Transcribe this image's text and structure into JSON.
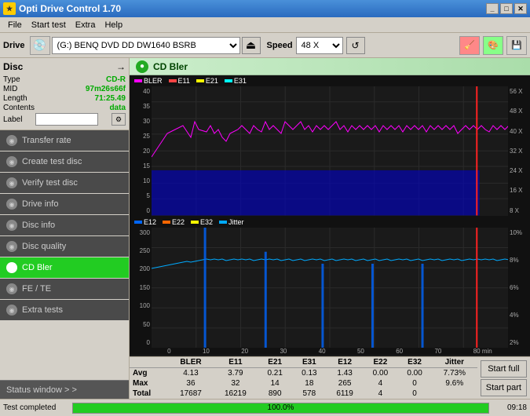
{
  "titleBar": {
    "title": "Opti Drive Control 1.70",
    "icon": "★"
  },
  "menuBar": {
    "items": [
      "File",
      "Start test",
      "Extra",
      "Help"
    ]
  },
  "toolbar": {
    "driveLabel": "Drive",
    "driveValue": "(G:)  BENQ DVD DD DW1640 BSRB",
    "speedLabel": "Speed",
    "speedValue": "48 X"
  },
  "disc": {
    "title": "Disc",
    "fields": [
      {
        "key": "Type",
        "value": "CD-R"
      },
      {
        "key": "MID",
        "value": "97m26s66f"
      },
      {
        "key": "Length",
        "value": "71:25.49"
      },
      {
        "key": "Contents",
        "value": "data"
      },
      {
        "key": "Label",
        "value": ""
      }
    ]
  },
  "sidebar": {
    "navItems": [
      {
        "id": "transfer-rate",
        "label": "Transfer rate",
        "active": false
      },
      {
        "id": "create-test-disc",
        "label": "Create test disc",
        "active": false
      },
      {
        "id": "verify-test-disc",
        "label": "Verify test disc",
        "active": false
      },
      {
        "id": "drive-info",
        "label": "Drive info",
        "active": false
      },
      {
        "id": "disc-info",
        "label": "Disc info",
        "active": false
      },
      {
        "id": "disc-quality",
        "label": "Disc quality",
        "active": false
      },
      {
        "id": "cd-bler",
        "label": "CD Bler",
        "active": true
      },
      {
        "id": "fe-te",
        "label": "FE / TE",
        "active": false
      },
      {
        "id": "extra-tests",
        "label": "Extra tests",
        "active": false
      }
    ],
    "statusWindowLabel": "Status window > >"
  },
  "chartHeader": {
    "title": "CD Bler"
  },
  "chart1": {
    "legend": [
      {
        "id": "bler",
        "label": "BLER",
        "color": "#ff00ff"
      },
      {
        "id": "e11",
        "label": "E11",
        "color": "#ff4444"
      },
      {
        "id": "e21",
        "label": "E21",
        "color": "#ffff00"
      },
      {
        "id": "e31",
        "label": "E31",
        "color": "#00ffff"
      }
    ],
    "yAxis": {
      "max": 40,
      "min": 0,
      "rightMax": "56 X",
      "rightMin": "8 X"
    },
    "xAxis": {
      "max": 80,
      "unit": "min"
    }
  },
  "chart2": {
    "legend": [
      {
        "id": "e12",
        "label": "E12",
        "color": "#0066ff"
      },
      {
        "id": "e22",
        "label": "E22",
        "color": "#ff6600"
      },
      {
        "id": "e32",
        "label": "E32",
        "color": "#ffff00"
      },
      {
        "id": "jitter",
        "label": "Jitter",
        "color": "#00aaff"
      }
    ],
    "yAxis": {
      "max": 300,
      "min": 0,
      "rightMax": "10%",
      "rightMin": "2%"
    },
    "xAxis": {
      "max": 80,
      "unit": "min"
    }
  },
  "dataTable": {
    "headers": [
      "",
      "BLER",
      "E11",
      "E21",
      "E31",
      "E12",
      "E22",
      "E32",
      "Jitter",
      ""
    ],
    "rows": [
      {
        "label": "Avg",
        "values": [
          "4.13",
          "3.79",
          "0.21",
          "0.13",
          "1.43",
          "0.00",
          "0.00",
          "7.73%"
        ]
      },
      {
        "label": "Max",
        "values": [
          "36",
          "32",
          "14",
          "18",
          "265",
          "4",
          "0",
          "9.6%"
        ]
      },
      {
        "label": "Total",
        "values": [
          "17687",
          "16219",
          "890",
          "578",
          "6119",
          "4",
          "0",
          ""
        ]
      }
    ]
  },
  "buttons": {
    "startFull": "Start full",
    "startPart": "Start part"
  },
  "statusBar": {
    "text": "Test completed",
    "progress": 100,
    "progressText": "100.0%",
    "time": "09:18"
  },
  "colors": {
    "accent": "#22cc22",
    "background": "#d4d0c8",
    "chartBg": "#1a1a1a",
    "gridLine": "#2a2a2a",
    "redLine": "#ff2222"
  }
}
